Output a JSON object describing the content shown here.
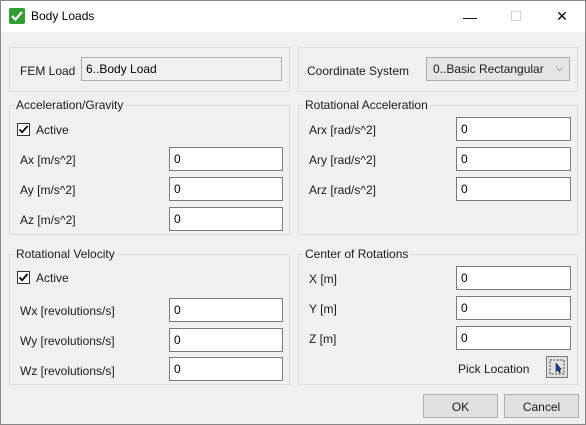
{
  "window": {
    "title": "Body Loads",
    "close_glyph": "✕",
    "min_glyph": "—",
    "max_glyph": "☐"
  },
  "fem_load": {
    "label": "FEM Load",
    "value": "6..Body Load"
  },
  "coordinate_system": {
    "label": "Coordinate System",
    "value": "0..Basic Rectangular"
  },
  "acceleration": {
    "title": "Acceleration/Gravity",
    "active_label": "Active",
    "active_checked": true,
    "fields": [
      {
        "label": "Ax  [m/s^2]",
        "value": "0"
      },
      {
        "label": "Ay  [m/s^2]",
        "value": "0"
      },
      {
        "label": "Az  [m/s^2]",
        "value": "0"
      }
    ]
  },
  "rotational_acceleration": {
    "title": "Rotational Acceleration",
    "fields": [
      {
        "label": "Arx [rad/s^2]",
        "value": "0"
      },
      {
        "label": "Ary [rad/s^2]",
        "value": "0"
      },
      {
        "label": "Arz [rad/s^2]",
        "value": "0"
      }
    ]
  },
  "rotational_velocity": {
    "title": "Rotational Velocity",
    "active_label": "Active",
    "active_checked": true,
    "fields": [
      {
        "label": "Wx [revolutions/s]",
        "value": "0"
      },
      {
        "label": "Wy [revolutions/s]",
        "value": "0"
      },
      {
        "label": "Wz [revolutions/s]",
        "value": "0"
      }
    ]
  },
  "center_of_rotations": {
    "title": "Center of Rotations",
    "fields": [
      {
        "label": "X  [m]",
        "value": "0"
      },
      {
        "label": "Y  [m]",
        "value": "0"
      },
      {
        "label": "Z  [m]",
        "value": "0"
      }
    ],
    "pick_label": "Pick Location"
  },
  "buttons": {
    "ok": "OK",
    "cancel": "Cancel"
  },
  "colors": {
    "title_icon": "#2e9e35",
    "background": "#f0f0f0"
  }
}
